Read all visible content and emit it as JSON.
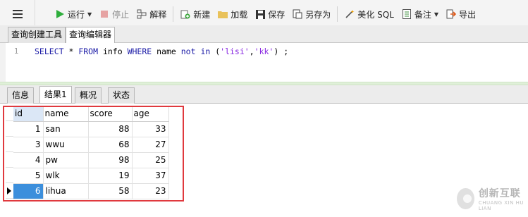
{
  "toolbar": {
    "run": "运行",
    "stop": "停止",
    "explain": "解释",
    "new": "新建",
    "load": "加载",
    "save": "保存",
    "save_as": "另存为",
    "beautify": "美化 SQL",
    "notes": "备注",
    "export": "导出"
  },
  "editor_tabs": [
    "查询创建工具",
    "查询编辑器"
  ],
  "editor": {
    "line_number": "1",
    "sql": {
      "t1": "SELECT",
      "t2": " * ",
      "t3": "FROM",
      "t4": " info ",
      "t5": "WHERE",
      "t6": " name ",
      "t7": "not in",
      "t8": " (",
      "t9": "'lisi'",
      "t10": ",",
      "t11": "'kk'",
      "t12": ") ;"
    }
  },
  "result_tabs": [
    "信息",
    "结果1",
    "概况",
    "状态"
  ],
  "grid": {
    "columns": [
      "id",
      "name",
      "score",
      "age"
    ],
    "rows": [
      {
        "id": "1",
        "name": "san",
        "score": "88",
        "age": "33"
      },
      {
        "id": "3",
        "name": "wwu",
        "score": "68",
        "age": "27"
      },
      {
        "id": "4",
        "name": "pw",
        "score": "98",
        "age": "25"
      },
      {
        "id": "5",
        "name": "wlk",
        "score": "19",
        "age": "37"
      },
      {
        "id": "6",
        "name": "lihua",
        "score": "58",
        "age": "23"
      }
    ]
  },
  "watermark": {
    "cn": "创新互联",
    "en": "CHUANG XIN HU LIAN"
  },
  "colors": {
    "highlight_border": "#e0393e",
    "selected_cell": "#3c8fdc",
    "splitter": "#dff0d8",
    "keyword": "#1a1aa6",
    "string": "#8a2be2"
  }
}
